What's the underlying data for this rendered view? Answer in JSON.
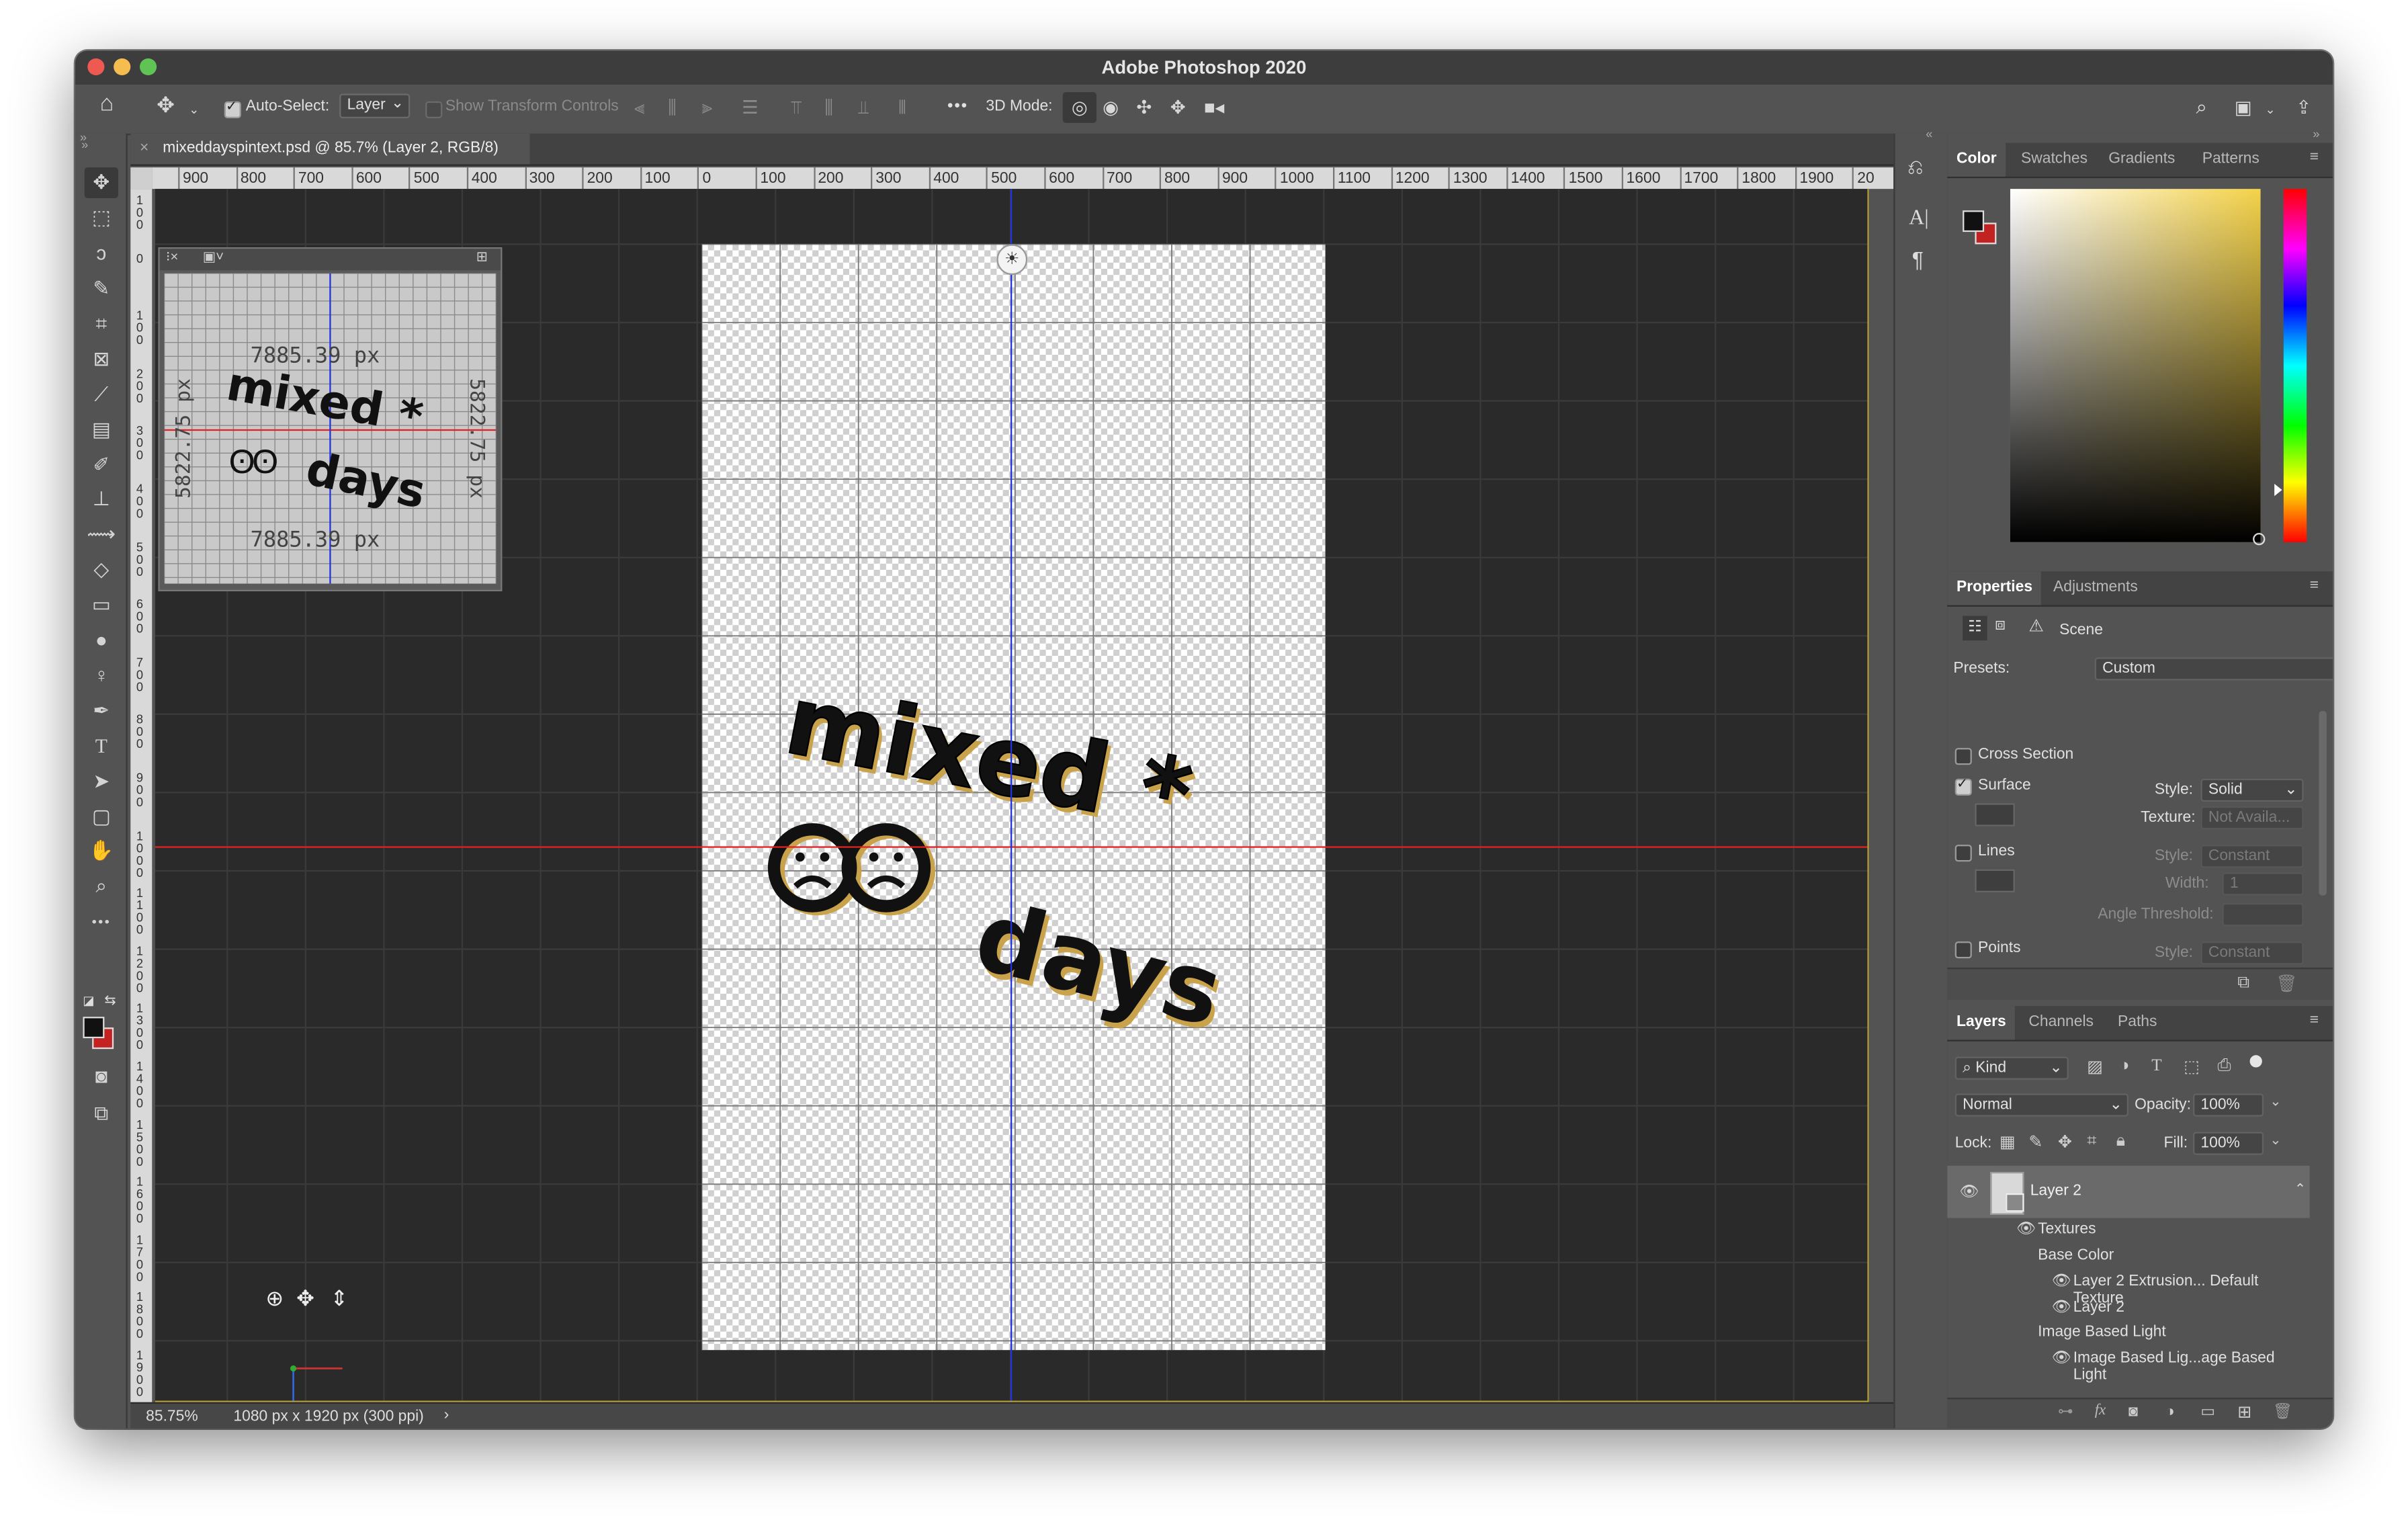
{
  "app": {
    "title": "Adobe Photoshop 2020",
    "accent": "#2f7ad1",
    "traffic": [
      "#ee5a52",
      "#f5bc4f",
      "#5fc454"
    ]
  },
  "options": {
    "auto_select_label": "Auto-Select:",
    "auto_select_checked": true,
    "layer_select": "Layer",
    "show_transform_label": "Show Transform Controls",
    "three_d_mode_label": "3D Mode:",
    "more_label": "•••"
  },
  "document": {
    "tab_title": "mixeddayspintext.psd @ 85.7% (Layer 2, RGB/8)",
    "close": "×",
    "zoom": "85.75%",
    "dimensions": "1080 px x 1920 px (300 ppi)",
    "status_arrow": "›"
  },
  "rulers": {
    "h_labels": [
      "900",
      "800",
      "700",
      "600",
      "500",
      "400",
      "300",
      "200",
      "100",
      "0",
      "100",
      "200",
      "300",
      "400",
      "500",
      "600",
      "700",
      "800",
      "900",
      "1000",
      "1100",
      "1200",
      "1300",
      "1400",
      "1500",
      "1600",
      "1700",
      "1800",
      "1900",
      "20"
    ],
    "v_labels": [
      "1 0 0",
      "0",
      "1 0 0",
      "2 0 0",
      "3 0 0",
      "4 0 0",
      "5 0 0",
      "6 0 0",
      "7 0 0",
      "8 0 0",
      "9 0 0",
      "1 0 0 0",
      "1 1 0 0",
      "1 2 0 0",
      "1 3 0 0",
      "1 4 0 0",
      "1 5 0 0",
      "1 6 0 0",
      "1 7 0 0",
      "1 8 0 0",
      "1 9 0 0"
    ]
  },
  "canvas": {
    "line1": "mixed *",
    "line2": "days",
    "faces": "ʘʘ",
    "light_icon": "☀",
    "navigator_width": "7885.39 px",
    "navigator_height": "5822.75 px",
    "navigator_title": "mixed *",
    "navigator_title2": "days",
    "widget_icons": [
      "⊕",
      "✥",
      "⇕"
    ]
  },
  "color_panel": {
    "tabs": [
      "Color",
      "Swatches",
      "Gradients",
      "Patterns"
    ],
    "active": "Color",
    "foreground": "#111111",
    "background": "#c22222",
    "hue": "#f4d24a"
  },
  "properties_panel": {
    "tabs": [
      "Properties",
      "Adjustments"
    ],
    "active": "Properties",
    "scene_label": "Scene",
    "presets_label": "Presets:",
    "presets_value": "Custom",
    "cross_section": {
      "label": "Cross Section",
      "checked": false
    },
    "surface": {
      "label": "Surface",
      "checked": true,
      "style_label": "Style:",
      "style_value": "Solid",
      "texture_label": "Texture:",
      "texture_value": "Not Availa..."
    },
    "lines": {
      "label": "Lines",
      "checked": false,
      "style_label": "Style:",
      "style_value": "Constant",
      "width_label": "Width:",
      "width_value": "1",
      "angle_label": "Angle Threshold:"
    },
    "points": {
      "label": "Points",
      "checked": false,
      "style_label": "Style:",
      "style_value": "Constant"
    }
  },
  "layers_panel": {
    "tabs": [
      "Layers",
      "Channels",
      "Paths"
    ],
    "active": "Layers",
    "filter_kind": "Kind",
    "blend_mode": "Normal",
    "opacity_label": "Opacity:",
    "opacity_value": "100%",
    "lock_label": "Lock:",
    "fill_label": "Fill:",
    "fill_value": "100%",
    "layers": [
      {
        "name": "Layer 2",
        "level": 0,
        "eye": true,
        "selected": true,
        "thumb": true
      },
      {
        "name": "Textures",
        "level": 1,
        "eye": true
      },
      {
        "name": "Base Color",
        "level": 2,
        "eye": false
      },
      {
        "name": "Layer 2 Extrusion... Default Texture",
        "level": 3,
        "eye": true
      },
      {
        "name": "Layer 2",
        "level": 3,
        "eye": true
      },
      {
        "name": "Image Based Light",
        "level": 2,
        "eye": false
      },
      {
        "name": "Image Based Lig...age Based Light",
        "level": 3,
        "eye": true
      }
    ],
    "footer_icons": [
      "link-icon",
      "fx-icon",
      "mask-icon",
      "adjustment-icon",
      "folder-icon",
      "new-layer-icon",
      "trash-icon"
    ]
  }
}
